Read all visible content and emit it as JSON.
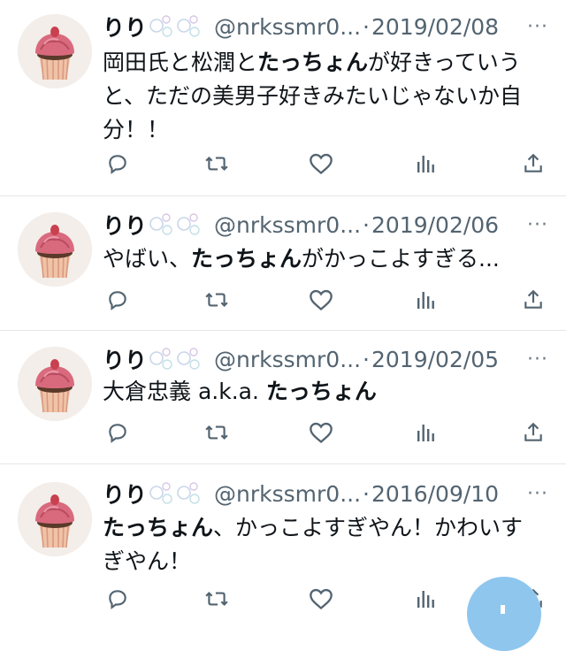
{
  "tweets": [
    {
      "name": "りり",
      "handle": "@nrkssmr0...",
      "sep": "·",
      "date": "2019/02/08",
      "more": "···",
      "text": [
        {
          "t": "岡田氏と松潤と",
          "b": false
        },
        {
          "t": "たっちょん",
          "b": true
        },
        {
          "t": "が好きっていうと、ただの美男子好きみたいじゃないか自分！！",
          "b": false
        }
      ]
    },
    {
      "name": "りり",
      "handle": "@nrkssmr0...",
      "sep": "·",
      "date": "2019/02/06",
      "more": "···",
      "text": [
        {
          "t": "やばい、",
          "b": false
        },
        {
          "t": "たっちょん",
          "b": true
        },
        {
          "t": "がかっこよすぎる...",
          "b": false
        }
      ]
    },
    {
      "name": "りり",
      "handle": "@nrkssmr0...",
      "sep": "·",
      "date": "2019/02/05",
      "more": "···",
      "text": [
        {
          "t": "大倉忠義 a.k.a. ",
          "b": false
        },
        {
          "t": "たっちょん",
          "b": true
        }
      ]
    },
    {
      "name": "りり",
      "handle": "@nrkssmr0...",
      "sep": "·",
      "date": "2016/09/10",
      "more": "···",
      "text": [
        {
          "t": "たっちょん",
          "b": true
        },
        {
          "t": "、かっこよすぎやん！かわいすぎやん！",
          "b": false
        }
      ]
    }
  ],
  "icons": {
    "reply": "reply-icon",
    "retweet": "retweet-icon",
    "like": "heart-icon",
    "views": "views-icon",
    "share": "share-icon",
    "compose": "compose-fab"
  },
  "colors": {
    "text": "#0f1419",
    "muted": "#536471",
    "icon": "#536471",
    "fab": "#8ec6ee"
  }
}
